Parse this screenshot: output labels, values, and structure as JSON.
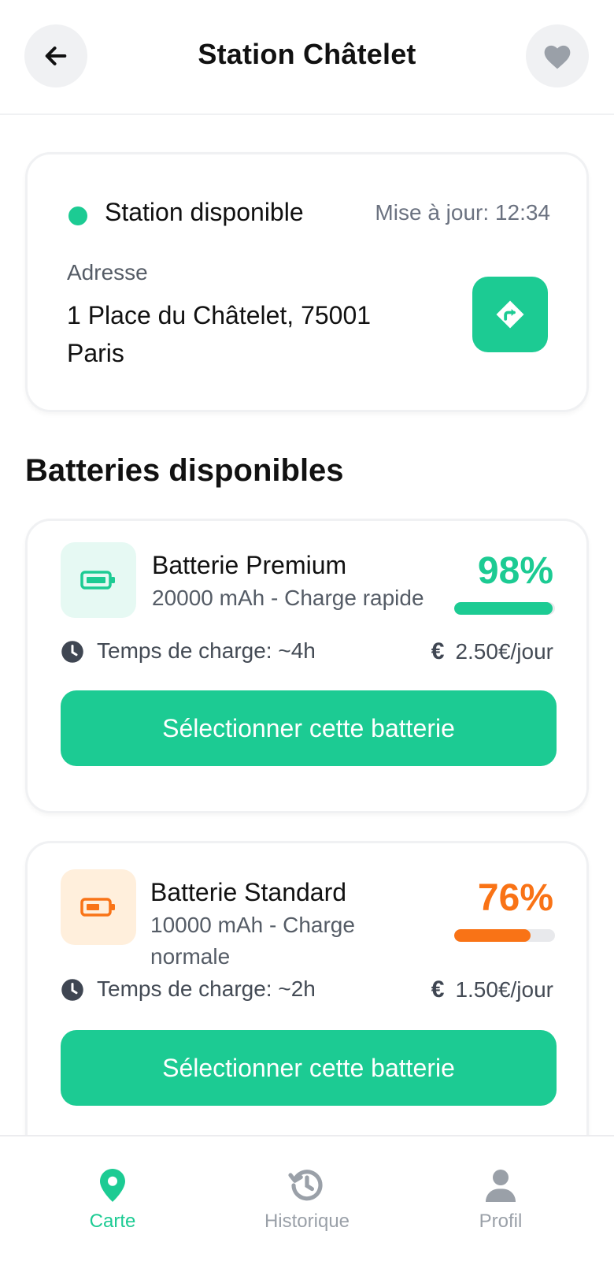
{
  "header": {
    "title": "Station Châtelet"
  },
  "station": {
    "status": "Station disponible",
    "status_color": "#1ccb93",
    "updated": "Mise à jour: 12:34",
    "address_label": "Adresse",
    "address_line1": "1 Place du Châtelet, 75001",
    "address_line2": "Paris"
  },
  "section_title": "Batteries disponibles",
  "batteries": [
    {
      "name": "Batterie Premium",
      "spec": "20000 mAh - Charge rapide",
      "percent_text": "98%",
      "level_percent": 98,
      "color": "#1ccb93",
      "icon_bg": "#e6f9f3",
      "charge_time": "Temps de charge: ~4h",
      "price": "2.50€/jour",
      "button": "Sélectionner cette batterie"
    },
    {
      "name": "Batterie Standard",
      "spec_line1": "10000 mAh - Charge",
      "spec_line2": "normale",
      "percent_text": "76%",
      "level_percent": 76,
      "color": "#f97316",
      "icon_bg": "#ffefdc",
      "charge_time": "Temps de charge: ~2h",
      "price": "1.50€/jour",
      "button": "Sélectionner cette batterie"
    }
  ],
  "nav": {
    "items": [
      {
        "label": "Carte",
        "icon": "map-pin-icon",
        "active": true
      },
      {
        "label": "Historique",
        "icon": "history-icon",
        "active": false
      },
      {
        "label": "Profil",
        "icon": "user-icon",
        "active": false
      }
    ],
    "active_color": "#1ccb93",
    "inactive_color": "#9aa0a8"
  },
  "colors": {
    "accent": "#1ccb93",
    "warning": "#f97316"
  }
}
